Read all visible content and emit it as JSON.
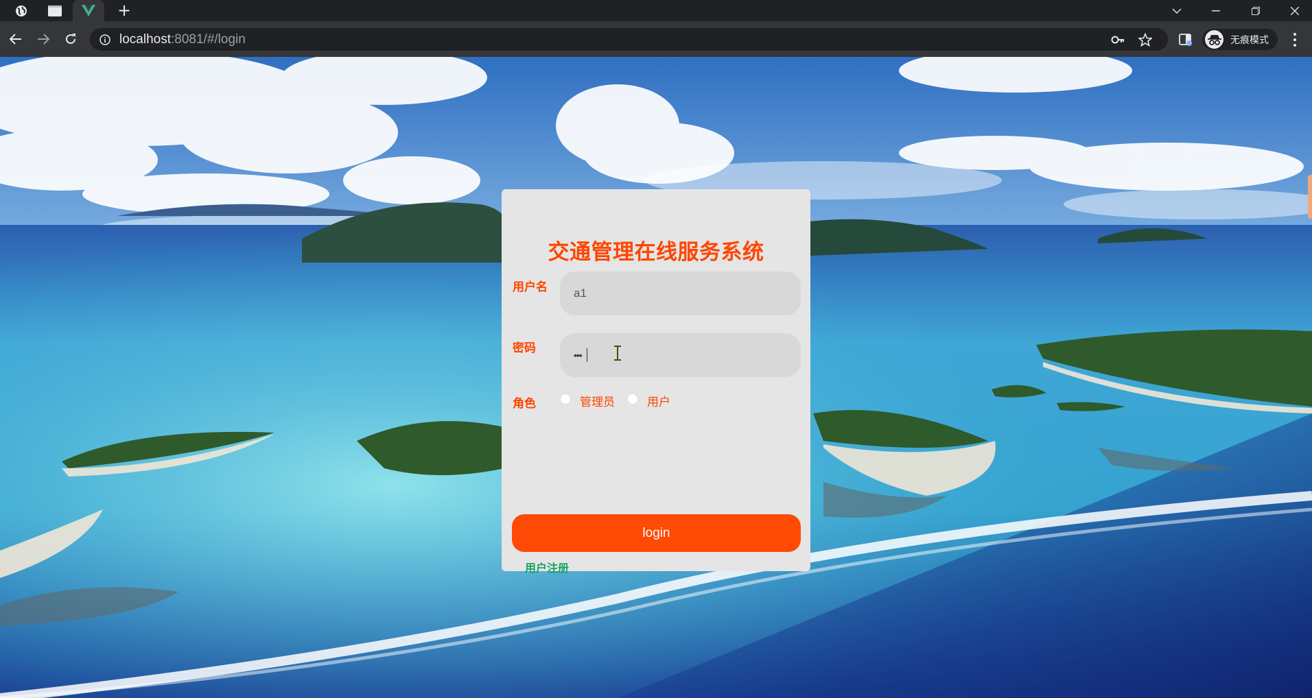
{
  "browser": {
    "url_host": "localhost",
    "url_rest": ":8081/#/login",
    "incognito_label": "无痕模式",
    "new_tab_symbol": "+"
  },
  "login": {
    "title": "交通管理在线服务系统",
    "username_label": "用户名",
    "username_value": "a1",
    "password_label": "密码",
    "password_mask": "•••",
    "role_label": "角色",
    "role_options": [
      "管理员",
      "用户"
    ],
    "login_button": "login",
    "register_link": "用户注册"
  },
  "colors": {
    "accent": "#ff4500",
    "button": "#ff4a05",
    "panel": "#e5e5e5",
    "input": "#d9d8d8",
    "register": "#13a363"
  }
}
